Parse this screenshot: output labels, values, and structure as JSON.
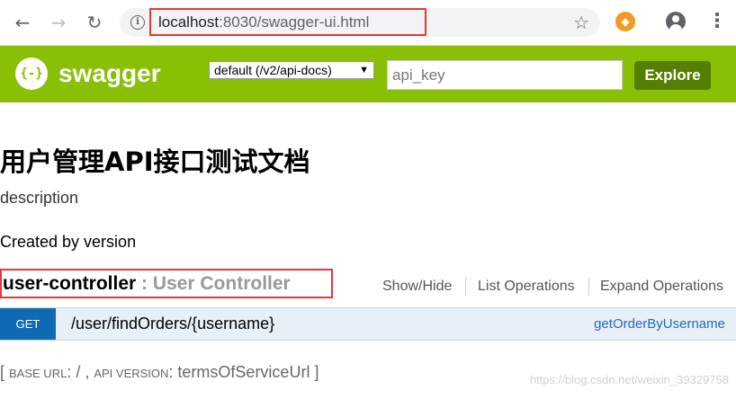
{
  "browser": {
    "url_host": "localhost",
    "url_rest": ":8030/swagger-ui.html",
    "back_icon": "←",
    "forward_icon": "→",
    "reload_icon": "↻",
    "info_icon": "i",
    "star_icon": "☆",
    "extension_icon": "◆",
    "menu_icon": "⋮"
  },
  "swagger": {
    "logo_glyph": "{-}",
    "brand": "swagger",
    "spec_select": "default (/v2/api-docs)",
    "spec_select_arrow": "▼",
    "api_key_placeholder": "api_key",
    "explore_label": "Explore",
    "accent": "#89bf04"
  },
  "page": {
    "title": "用户管理API接口测试文档",
    "description": "description",
    "created_by": "Created by version"
  },
  "controller": {
    "name": "user-controller",
    "desc": " : User Controller",
    "ops": {
      "show_hide": "Show/Hide",
      "list": "List Operations",
      "expand": "Expand Operations"
    }
  },
  "operations": [
    {
      "method": "GET",
      "path": "/user/findOrders/{username}",
      "operation_id": "getOrderByUsername"
    }
  ],
  "footer": {
    "open_bracket": "[ ",
    "base_url_label": "BASE URL",
    "base_url_value": ": / , ",
    "api_version_label": "API VERSION",
    "api_version_value": ": termsOfServiceUrl ]"
  },
  "watermark": "https://blog.csdn.net/weixin_39329758"
}
